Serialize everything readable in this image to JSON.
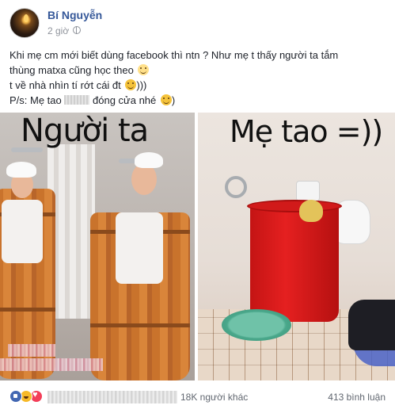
{
  "post": {
    "author": "Bí Nguyễn",
    "time": "2 giờ",
    "text_lines": [
      "Khi mẹ cm mới biết dùng facebook thì ntn ? Như mẹ t thấy người ta tắm",
      "thùng matxa cũng học theo",
      "t về nhà nhìn tí rớt cái đt",
      ")))",
      "P/s: Mẹ tao",
      "đóng cửa nhé",
      ")"
    ]
  },
  "photos": {
    "left_caption": "Người ta",
    "right_caption": "Mẹ tao =))"
  },
  "footer": {
    "reactions": [
      "like-icon",
      "haha-icon",
      "love-icon"
    ],
    "likes_text": "18K người khác",
    "comments_text": "413 bình luận"
  },
  "colors": {
    "author_link": "#365899",
    "secondary_text": "#90949c",
    "like_blue": "#4267b2",
    "haha_yellow": "#f7b928",
    "love_red": "#f33e58"
  }
}
